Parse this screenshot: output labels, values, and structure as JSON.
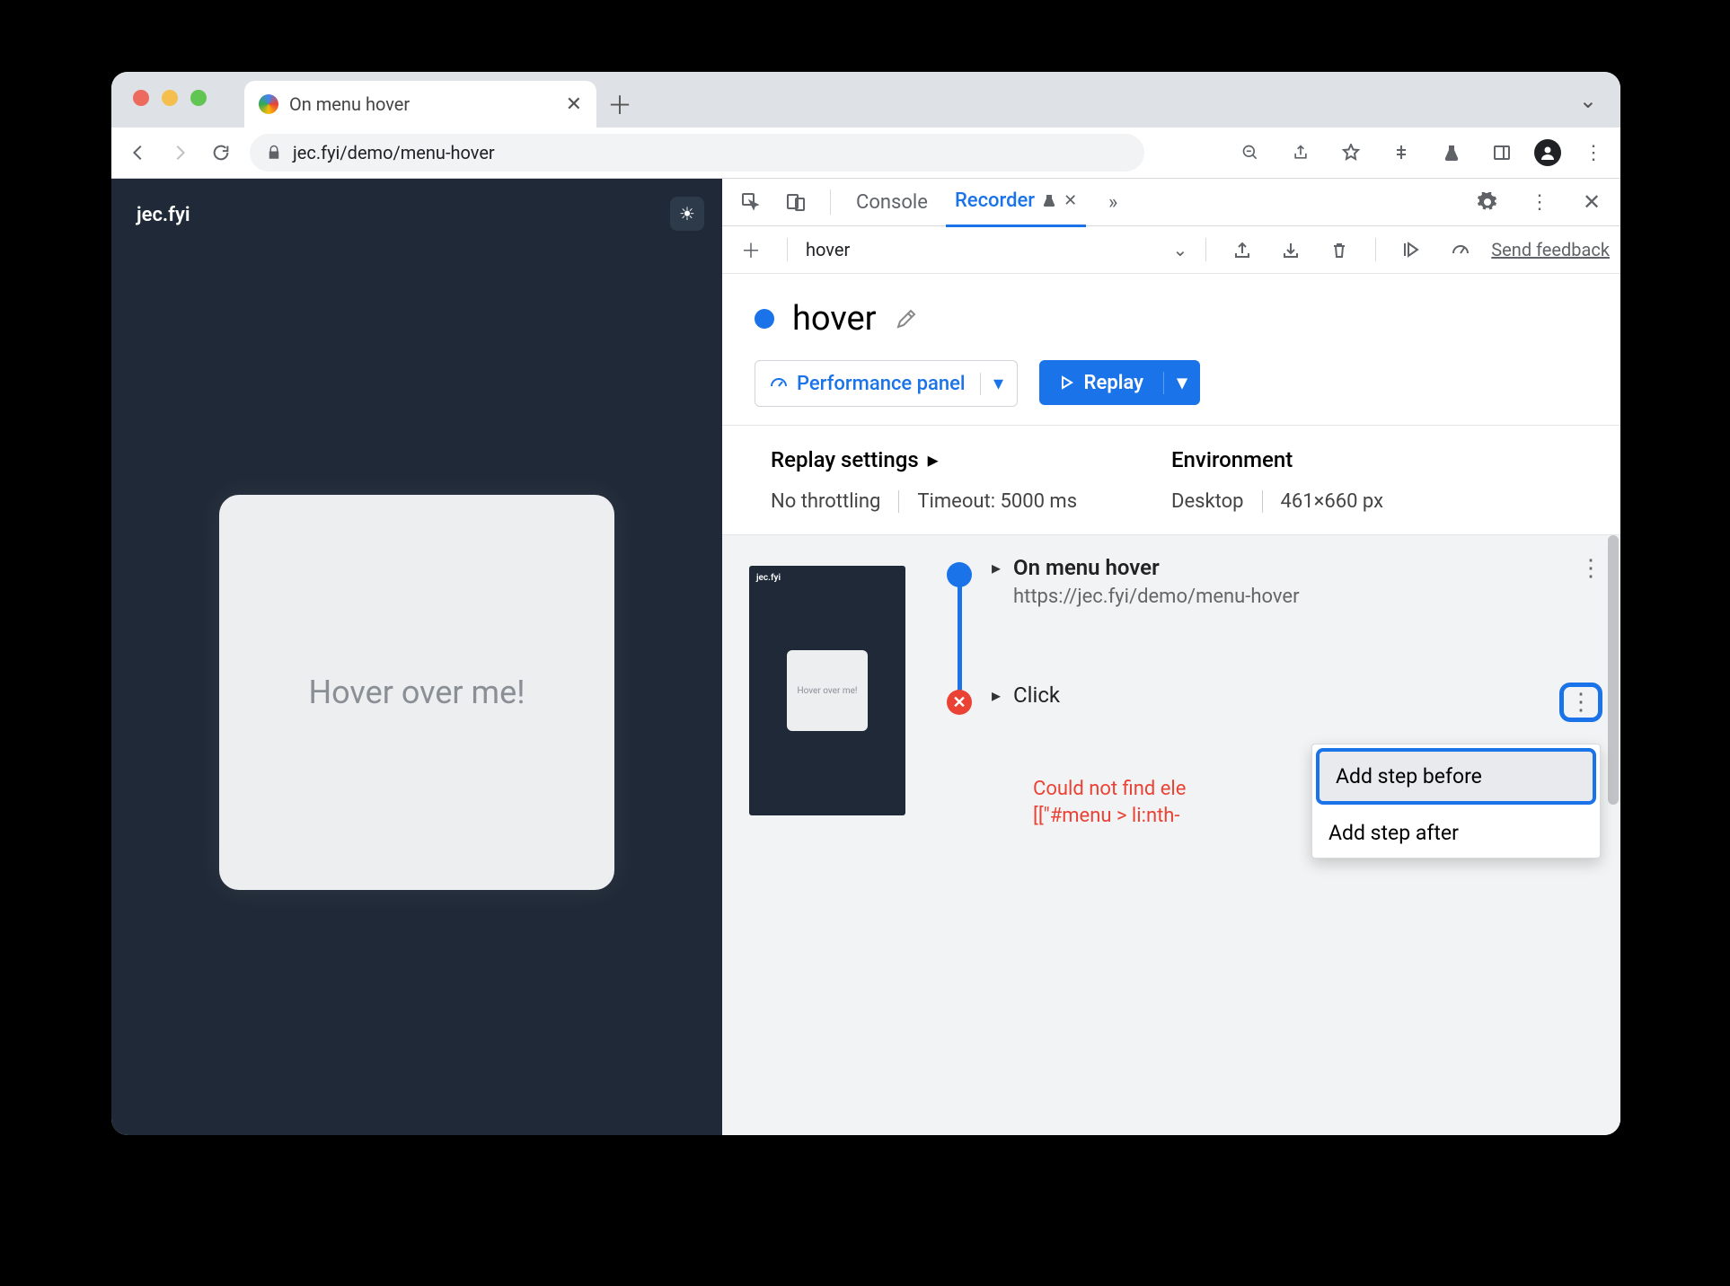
{
  "browser": {
    "tab_title": "On menu hover",
    "url_display": "jec.fyi/demo/menu-hover"
  },
  "page": {
    "brand": "jec.fyi",
    "card_text": "Hover over me!"
  },
  "devtools": {
    "tabs": {
      "console": "Console",
      "recorder": "Recorder"
    },
    "recording_select": "hover",
    "feedback": "Send feedback",
    "recording_title": "hover",
    "perf_button": "Performance panel",
    "replay_button": "Replay",
    "settings": {
      "replay_heading": "Replay settings",
      "throttling": "No throttling",
      "timeout": "Timeout: 5000 ms",
      "env_heading": "Environment",
      "env_device": "Desktop",
      "env_size": "461×660 px"
    }
  },
  "steps": {
    "thumb_card": "Hover over me!",
    "s1": {
      "title": "On menu hover",
      "url": "https://jec.fyi/demo/menu-hover"
    },
    "s2": {
      "title": "Click"
    },
    "error_l1": "Could not find ele",
    "error_l2": "[[\"#menu > li:nth-"
  },
  "menu": {
    "before": "Add step before",
    "after": "Add step after"
  }
}
